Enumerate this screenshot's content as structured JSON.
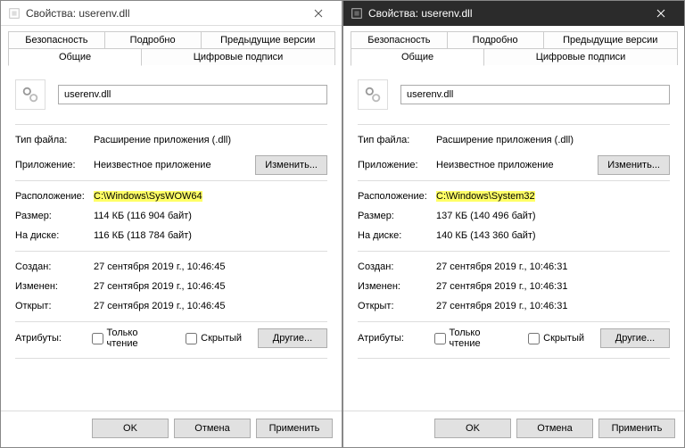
{
  "common": {
    "tabs": {
      "security": "Безопасность",
      "details": "Подробно",
      "previous": "Предыдущие версии",
      "general": "Общие",
      "signatures": "Цифровые подписи"
    },
    "labels": {
      "file_type": "Тип файла:",
      "application": "Приложение:",
      "location": "Расположение:",
      "size": "Размер:",
      "on_disk": "На диске:",
      "created": "Создан:",
      "modified": "Изменен:",
      "accessed": "Открыт:",
      "attributes": "Атрибуты:",
      "readonly": "Только чтение",
      "hidden": "Скрытый"
    },
    "buttons": {
      "change": "Изменить...",
      "other": "Другие...",
      "ok": "OK",
      "cancel": "Отмена",
      "apply": "Применить"
    },
    "file_type_value": "Расширение приложения (.dll)",
    "app_value": "Неизвестное приложение"
  },
  "left": {
    "title": "Свойства: userenv.dll",
    "filename": "userenv.dll",
    "location": "C:\\Windows\\SysWOW64",
    "size": "114 КБ (116 904 байт)",
    "on_disk": "116 КБ (118 784 байт)",
    "created": "27 сентября 2019 г., 10:46:45",
    "modified": "27 сентября 2019 г., 10:46:45",
    "accessed": "27 сентября 2019 г., 10:46:45"
  },
  "right": {
    "title": "Свойства: userenv.dll",
    "filename": "userenv.dll",
    "location": "C:\\Windows\\System32",
    "size": "137 КБ (140 496 байт)",
    "on_disk": "140 КБ (143 360 байт)",
    "created": "27 сентября 2019 г., 10:46:31",
    "modified": "27 сентября 2019 г., 10:46:31",
    "accessed": "27 сентября 2019 г., 10:46:31"
  }
}
